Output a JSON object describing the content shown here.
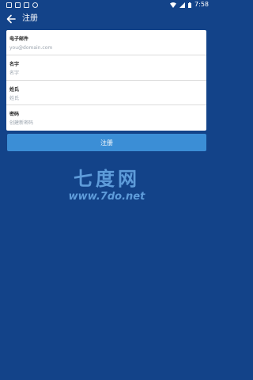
{
  "status_bar": {
    "time": "7:58"
  },
  "app_bar": {
    "title": "注册",
    "back_icon": "arrow-left-icon"
  },
  "form": {
    "fields": [
      {
        "label": "电子邮件",
        "placeholder": "you@domain.com",
        "value": ""
      },
      {
        "label": "名字",
        "placeholder": "名字",
        "value": ""
      },
      {
        "label": "姓氏",
        "placeholder": "姓氏",
        "value": ""
      },
      {
        "label": "密码",
        "placeholder": "创建新密码",
        "value": ""
      }
    ]
  },
  "submit": {
    "label": "注册"
  },
  "watermark": {
    "title": "七度网",
    "url": "www.7do.net"
  },
  "colors": {
    "background": "#134389",
    "button": "#3b8ed6",
    "card": "#ffffff"
  }
}
